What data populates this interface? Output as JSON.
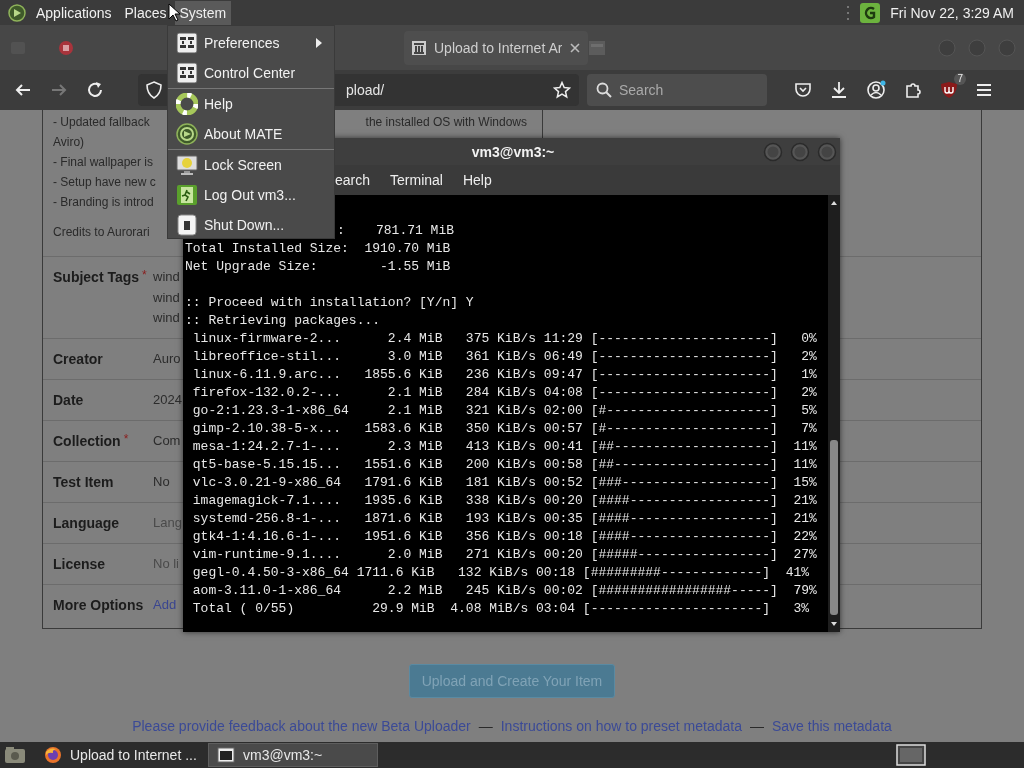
{
  "top_panel": {
    "menus": [
      {
        "label": "Applications",
        "selected": false
      },
      {
        "label": "Places",
        "selected": false
      },
      {
        "label": "System",
        "selected": true
      }
    ],
    "clock": "Fri Nov 22, 3:29 AM"
  },
  "system_menu": {
    "groups": [
      [
        {
          "label": "Preferences",
          "has_submenu": true
        },
        {
          "label": "Control Center",
          "has_submenu": false
        }
      ],
      [
        {
          "label": "Help",
          "has_submenu": false
        },
        {
          "label": "About MATE",
          "has_submenu": false
        }
      ],
      [
        {
          "label": "Lock Screen",
          "has_submenu": false
        },
        {
          "label": "Log Out vm3...",
          "has_submenu": false
        },
        {
          "label": "Shut Down...",
          "has_submenu": false
        }
      ]
    ]
  },
  "browser": {
    "tabs": [
      {
        "label": "Upload to Internet Ar",
        "selected": true
      }
    ],
    "url": "pload/",
    "search_placeholder": "Search",
    "extension_badge": "7"
  },
  "page": {
    "description": {
      "first_left": "- Updated fallback",
      "first_right": "the installed OS with Windows",
      "lines": [
        "Aviro)",
        "- Final wallpaper is",
        "- Setup have new c",
        "- Branding is introd"
      ],
      "credits": "Credits to Aurorari"
    },
    "fields": [
      {
        "label": "Subject Tags",
        "required_mark": "*",
        "kind": "value",
        "values": [
          "wind",
          "wind",
          "wind"
        ]
      },
      {
        "label": "Creator",
        "kind": "value",
        "values": [
          "Auro"
        ]
      },
      {
        "label": "Date",
        "kind": "value",
        "values": [
          "2024"
        ]
      },
      {
        "label": "Collection",
        "required_mark": "*",
        "kind": "value",
        "values": [
          "Com"
        ]
      },
      {
        "label": "Test Item",
        "kind": "value",
        "values": [
          "No"
        ]
      },
      {
        "label": "Language",
        "kind": "placeholder",
        "values": [
          "Lang"
        ]
      },
      {
        "label": "License",
        "kind": "placeholder",
        "values": [
          "No li"
        ]
      },
      {
        "label": "More Options",
        "kind": "link",
        "values": [
          "Add"
        ]
      }
    ],
    "upload_button": "Upload and Create Your Item",
    "footer": [
      {
        "text": "Please provide feedback about the new Beta Uploader",
        "kind": "link"
      },
      {
        "text": "—",
        "kind": "separator"
      },
      {
        "text": "Instructions on how to preset metadata",
        "kind": "link"
      },
      {
        "text": "—",
        "kind": "separator"
      },
      {
        "text": "Save this metadata",
        "kind": "link"
      }
    ]
  },
  "terminal": {
    "title": "vm3@vm3:~",
    "menus": [
      "earch",
      "Terminal",
      "Help"
    ],
    "lines": [
      {
        "kind": "partial",
        "text": ":    781.71 MiB"
      },
      {
        "kind": "line",
        "text": "Total Installed Size:  1910.70 MiB"
      },
      {
        "kind": "line",
        "text": "Net Upgrade Size:        -1.55 MiB"
      },
      {
        "kind": "blank"
      },
      {
        "kind": "line",
        "text": ":: Proceed with installation? [Y/n] Y"
      },
      {
        "kind": "line",
        "text": ":: Retrieving packages..."
      },
      {
        "kind": "line",
        "text": " linux-firmware-2...      2.4 MiB   375 KiB/s 11:29 [----------------------]   0%"
      },
      {
        "kind": "line",
        "text": " libreoffice-stil...      3.0 MiB   361 KiB/s 06:49 [----------------------]   2%"
      },
      {
        "kind": "line",
        "text": " linux-6.11.9.arc...   1855.6 KiB   236 KiB/s 09:47 [----------------------]   1%"
      },
      {
        "kind": "line",
        "text": " firefox-132.0.2-...      2.1 MiB   284 KiB/s 04:08 [----------------------]   2%"
      },
      {
        "kind": "line",
        "text": " go-2:1.23.3-1-x86_64     2.1 MiB   321 KiB/s 02:00 [#---------------------]   5%"
      },
      {
        "kind": "line",
        "text": " gimp-2.10.38-5-x...   1583.6 KiB   350 KiB/s 00:57 [#---------------------]   7%"
      },
      {
        "kind": "line",
        "text": " mesa-1:24.2.7-1-...      2.3 MiB   413 KiB/s 00:41 [##--------------------]  11%"
      },
      {
        "kind": "line",
        "text": " qt5-base-5.15.15...   1551.6 KiB   200 KiB/s 00:58 [##--------------------]  11%"
      },
      {
        "kind": "line",
        "text": " vlc-3.0.21-9-x86_64   1791.6 KiB   181 KiB/s 00:52 [###-------------------]  15%"
      },
      {
        "kind": "line",
        "text": " imagemagick-7.1....   1935.6 KiB   338 KiB/s 00:20 [####------------------]  21%"
      },
      {
        "kind": "line",
        "text": " systemd-256.8-1-...   1871.6 KiB   193 KiB/s 00:35 [####------------------]  21%"
      },
      {
        "kind": "line",
        "text": " gtk4-1:4.16.6-1-...   1951.6 KiB   356 KiB/s 00:18 [####------------------]  22%"
      },
      {
        "kind": "line",
        "text": " vim-runtime-9.1....      2.0 MiB   271 KiB/s 00:20 [#####-----------------]  27%"
      },
      {
        "kind": "line",
        "text": " gegl-0.4.50-3-x86_64 1711.6 KiB   132 KiB/s 00:18 [#########-------------]  41%"
      },
      {
        "kind": "line",
        "text": " aom-3.11.0-1-x86_64      2.2 MiB   245 KiB/s 00:02 [#################-----]  79%"
      },
      {
        "kind": "line",
        "text": " Total ( 0/55)          29.9 MiB  4.08 MiB/s 03:04 [----------------------]   3%"
      }
    ]
  },
  "taskbar": {
    "tasks": [
      {
        "label": "Upload to Internet ...",
        "selected": false
      },
      {
        "label": "vm3@vm3:~",
        "selected": true
      }
    ]
  }
}
